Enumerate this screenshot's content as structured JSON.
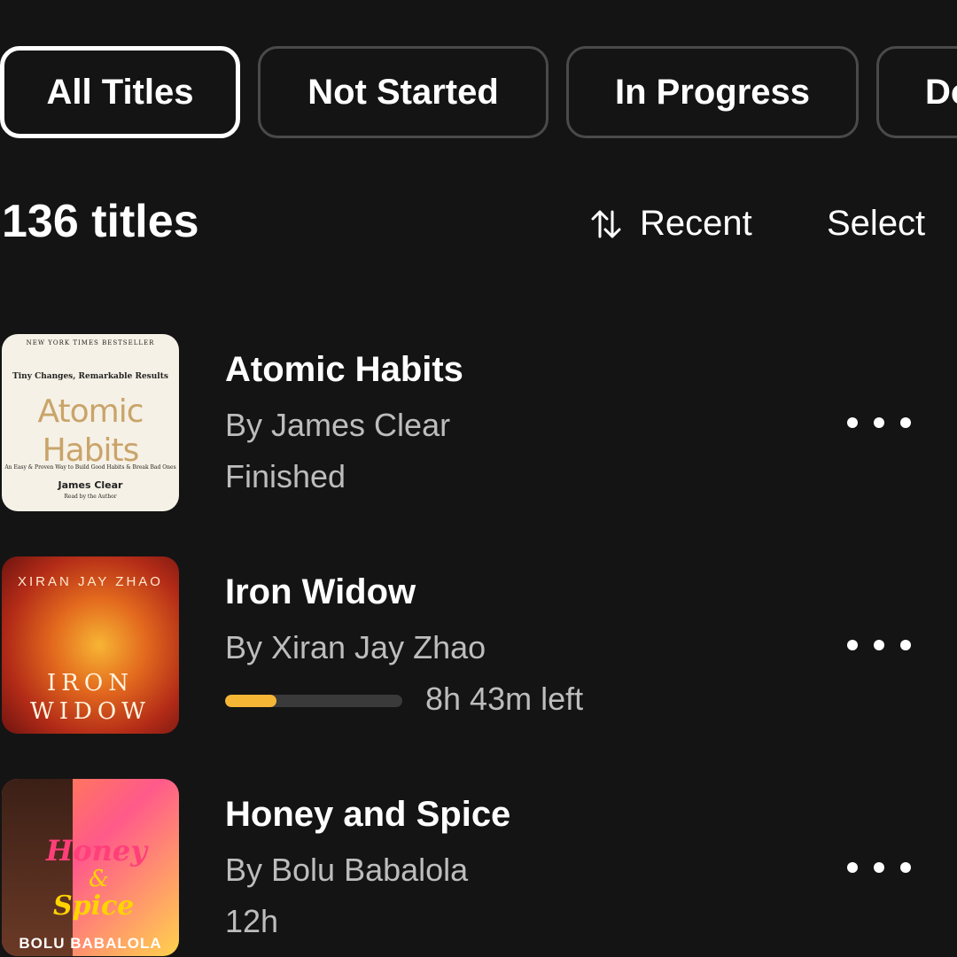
{
  "filters": {
    "chips": [
      {
        "label": "All Titles",
        "active": true
      },
      {
        "label": "Not Started",
        "active": false
      },
      {
        "label": "In Progress",
        "active": false
      },
      {
        "label": "Do",
        "active": false
      }
    ]
  },
  "toolbar": {
    "count": "136 titles",
    "sort_icon": "sort-arrows-icon",
    "sort_label": "Recent",
    "select_label": "Select"
  },
  "books": [
    {
      "title": "Atomic Habits",
      "author": "By James Clear",
      "status": "Finished",
      "cover": {
        "top_line": "NEW YORK TIMES BESTSELLER",
        "subtitle": "Tiny Changes, Remarkable Results",
        "title_line1": "Atomic",
        "title_line2": "Habits",
        "tagline": "An Easy & Proven Way to Build Good Habits & Break Bad Ones",
        "author": "James Clear",
        "read_by": "Read by the Author"
      }
    },
    {
      "title": "Iron Widow",
      "author": "By Xiran Jay Zhao",
      "progress": 0.29,
      "progress_color": "#f5b636",
      "time_left": "8h 43m left",
      "cover": {
        "author": "XIRAN JAY ZHAO",
        "title_line1": "IRON",
        "title_line2": "WIDOW"
      }
    },
    {
      "title": "Honey and Spice",
      "author": "By Bolu Babalola",
      "status": "12h",
      "cover": {
        "title_line1": "Honey",
        "amp": "&",
        "title_line2": "Spice",
        "author": "BOLU BABALOLA"
      }
    }
  ],
  "more_icon": "more-horizontal-icon"
}
